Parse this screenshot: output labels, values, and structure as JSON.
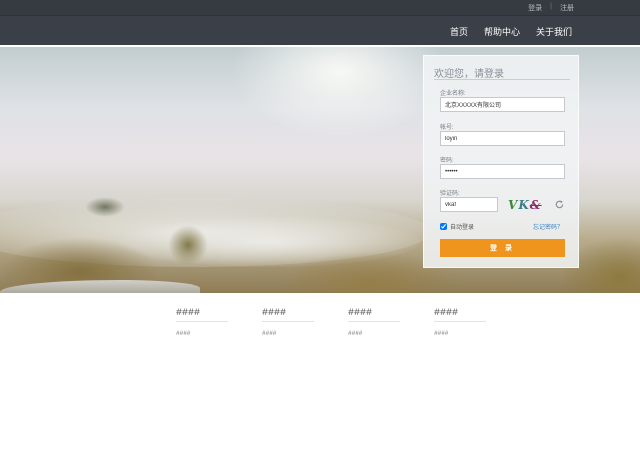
{
  "topbar": {
    "login_link": "登录",
    "separator": "|",
    "register_link": "注册"
  },
  "nav": {
    "items": [
      "首页",
      "帮助中心",
      "关于我们"
    ]
  },
  "login": {
    "title": "欢迎您，请登录",
    "company_label": "企业名称:",
    "company_value": "北京XXXXX有限公司",
    "account_label": "帐号:",
    "account_value": "loyin",
    "password_label": "密码:",
    "password_value": "••••••",
    "captcha_label": "验证码:",
    "captcha_value": "vkaf",
    "captcha_chars": [
      "V",
      "K",
      "&"
    ],
    "remember_label": "自动登录",
    "remember_checked": true,
    "forgot_link": "忘记密码？",
    "submit_label": "登 录",
    "accent_color": "#ef941d"
  },
  "footer": {
    "columns": [
      {
        "heading": "####",
        "text": "####"
      },
      {
        "heading": "####",
        "text": "####"
      },
      {
        "heading": "####",
        "text": "####"
      },
      {
        "heading": "####",
        "text": "####"
      }
    ]
  },
  "icons": {
    "refresh": "refresh-icon"
  },
  "colors": {
    "topbar": "#363a41",
    "navbar": "#3b3f47",
    "link": "#3b82c4"
  }
}
